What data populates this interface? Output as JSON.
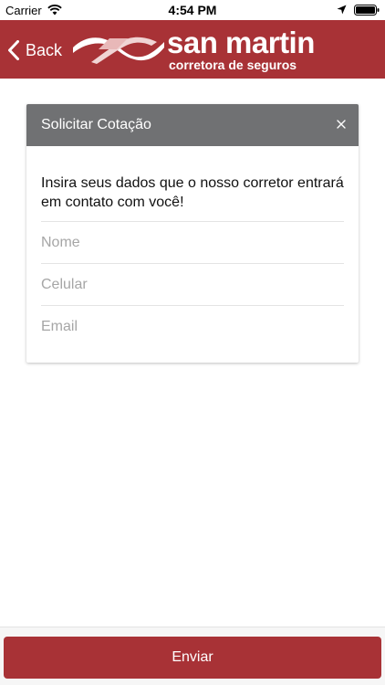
{
  "status_bar": {
    "carrier": "Carrier",
    "time": "4:54 PM",
    "icons": [
      "wifi-icon",
      "location-icon",
      "battery-icon"
    ]
  },
  "header": {
    "back_label": "Back",
    "logo_name": "san martin",
    "logo_tagline": "corretora de seguros",
    "background_color": "#a83236"
  },
  "card": {
    "title": "Solicitar Cotação",
    "close_icon": "close-icon",
    "intro": "Insira seus dados que o nosso corretor entrará em contato com você!",
    "fields": {
      "name_placeholder": "Nome",
      "phone_placeholder": "Celular",
      "email_placeholder": "Email"
    },
    "header_color": "#707173"
  },
  "footer": {
    "submit_label": "Enviar",
    "button_color": "#a83236"
  }
}
